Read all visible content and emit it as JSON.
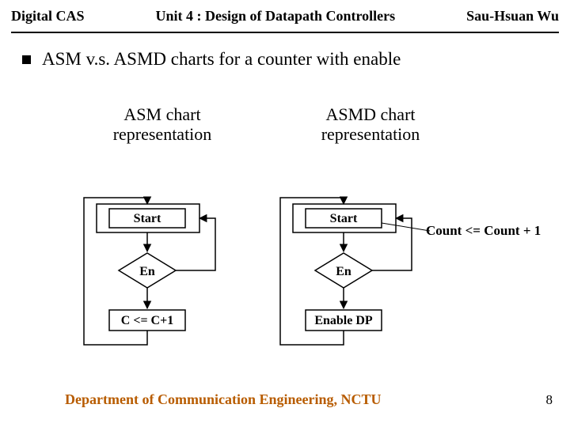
{
  "header": {
    "left": "Digital CAS",
    "center": "Unit 4 : Design of Datapath Controllers",
    "right": "Sau-Hsuan Wu"
  },
  "bullet": "ASM v.s. ASMD charts for a counter with enable",
  "columns": {
    "left_l1": "ASM chart",
    "left_l2": "representation",
    "right_l1": "ASMD chart",
    "right_l2": "representation"
  },
  "asm": {
    "state": "Start",
    "decision": "En",
    "action": "C <= C+1"
  },
  "asmd": {
    "state": "Start",
    "decision": "En",
    "action": "Enable DP"
  },
  "annotation": "Count <= Count + 1",
  "footer": "Department of Communication Engineering, NCTU",
  "page_number": "8"
}
